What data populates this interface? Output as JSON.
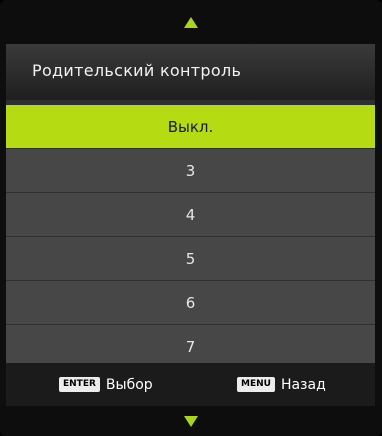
{
  "menu": {
    "title": "Родительский контроль",
    "options": [
      {
        "label": "Выкл.",
        "selected": true
      },
      {
        "label": "3",
        "selected": false
      },
      {
        "label": "4",
        "selected": false
      },
      {
        "label": "5",
        "selected": false
      },
      {
        "label": "6",
        "selected": false
      },
      {
        "label": "7",
        "selected": false
      }
    ]
  },
  "footer": {
    "enter_key": "ENTER",
    "enter_action": "Выбор",
    "menu_key": "MENU",
    "menu_action": "Назад"
  },
  "navigation": {
    "up_icon": "arrow-up-icon",
    "down_icon": "arrow-down-icon"
  },
  "colors": {
    "accent": "#b5dc12",
    "arrow": "#a8d61b",
    "item_bg": "#474747",
    "header_bg": "#2b2b2b"
  }
}
